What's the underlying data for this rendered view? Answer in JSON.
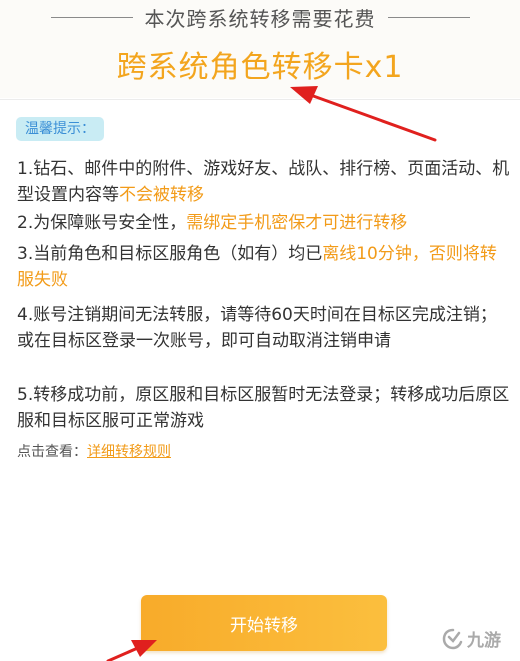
{
  "cost": {
    "title": "本次跨系统转移需要花费",
    "card_name": "跨系统角色转移卡x1"
  },
  "tips": {
    "badge": "温馨提示：",
    "items": [
      {
        "parts": [
          {
            "text": "1.钻石、邮件中的附件、游戏好友、战队、排行榜、页面活动、机型设置内容等",
            "hl": false
          },
          {
            "text": "不会被转移",
            "hl": true
          }
        ]
      },
      {
        "parts": [
          {
            "text": "2.为保障账号安全性，",
            "hl": false
          },
          {
            "text": "需绑定手机密保才可进行转移",
            "hl": true
          }
        ]
      },
      {
        "parts": [
          {
            "text": "3.当前角色和目标区服角色（如有）均已",
            "hl": false
          },
          {
            "text": "离线10分钟，否则将转服失败",
            "hl": true
          }
        ]
      },
      {
        "parts": [
          {
            "text": "4.账号注销期间无法转服，请等待60天时间在目标区完成注销；或在目标区登录一次账号，即可自动取消注销申请",
            "hl": false
          }
        ]
      },
      {
        "parts": [
          {
            "text": "5.转移成功前，原区服和目标区服暂时无法登录；转移成功后原区服和目标区服可正常游戏",
            "hl": false
          }
        ]
      }
    ]
  },
  "rules": {
    "prefix": "点击查看：",
    "link": "详细转移规则"
  },
  "start_button": "开始转移",
  "watermark": "九游",
  "colors": {
    "accent": "#f29b19",
    "badge_bg": "#c9ecf4",
    "badge_text": "#3b8fd6",
    "annotation_arrow": "#e0201e"
  },
  "icons": {
    "watermark": "jiuyou-logo-icon",
    "annotation": "red-arrow-annotation"
  }
}
